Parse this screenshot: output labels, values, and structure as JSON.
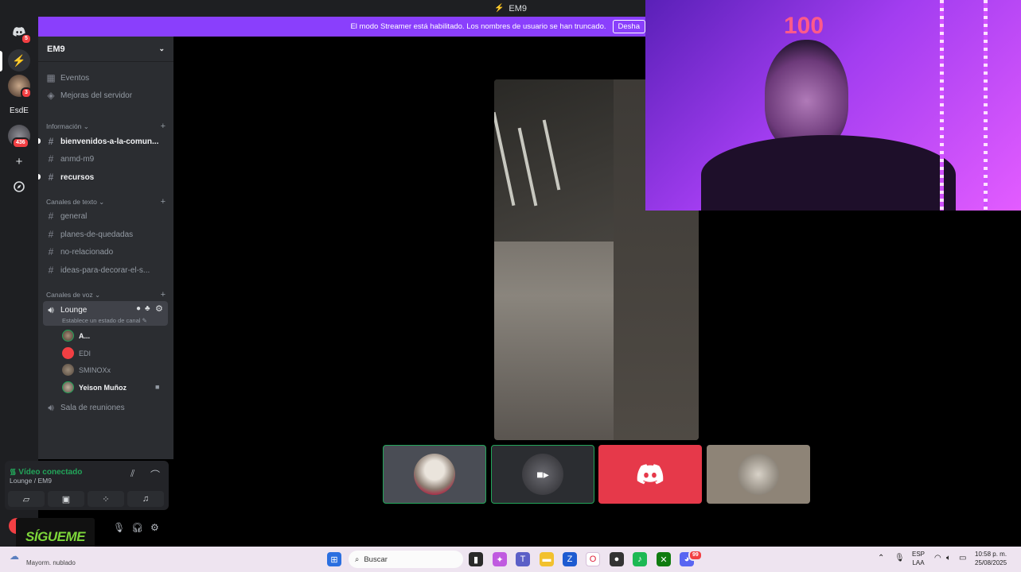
{
  "titlebar": {
    "title": "EM9"
  },
  "banner": {
    "message": "El modo Streamer está habilitado. Los nombres de usuario se han truncado.",
    "button": "Desha"
  },
  "rail": {
    "badge_dm": "5",
    "badge_server2": "3",
    "server_esde": "EsdE",
    "badge_server4": "436"
  },
  "guild": {
    "name": "EM9",
    "events": "Eventos",
    "boosts": "Mejoras del servidor",
    "cat_info": "Información",
    "info_channels": [
      "bienvenidos-a-la-comun...",
      "anmd-m9",
      "recursos"
    ],
    "cat_text": "Canales de texto",
    "text_channels": [
      "general",
      "planes-de-quedadas",
      "no-relacionado",
      "ideas-para-decorar-el-s..."
    ],
    "cat_voice": "Canales de voz",
    "voice_channel": "Lounge",
    "voice_status": "Establece un estado de canal",
    "members": [
      "A...",
      "EDI",
      "SMINOXx",
      "Yeison Muñoz"
    ],
    "meeting_room": "Sala de reuniones"
  },
  "voice_panel": {
    "status": "Vídeo conectado",
    "location": "Lounge / EM9"
  },
  "overlay": {
    "sigueme": "SÍGUEME"
  },
  "cam": {
    "neon": "100"
  },
  "taskbar": {
    "search_placeholder": "Buscar",
    "weather": "Mayorm. nublado",
    "lang_top": "ESP",
    "lang_bottom": "LAA",
    "time": "10:58 p. m.",
    "date": "25/08/2025",
    "badge": "99"
  },
  "colors": {
    "brand": "#5865f2",
    "online": "#23a55a",
    "banner": "#8a3ffc",
    "danger": "#f23f43"
  }
}
